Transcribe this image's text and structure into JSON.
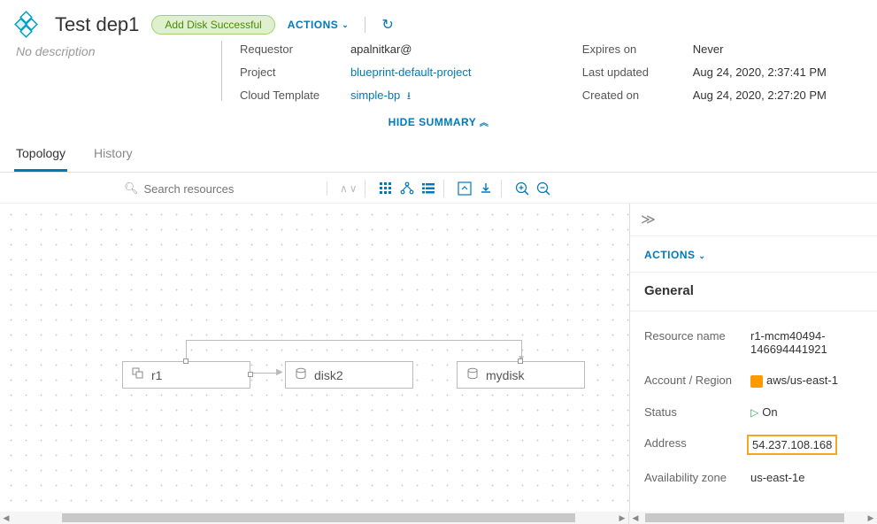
{
  "header": {
    "title": "Test dep1",
    "badge": "Add Disk Successful",
    "actions_label": "ACTIONS",
    "no_description": "No description"
  },
  "info": {
    "requestor_label": "Requestor",
    "requestor_value": "apalnitkar@",
    "project_label": "Project",
    "project_value": "blueprint-default-project",
    "template_label": "Cloud Template",
    "template_value": "simple-bp",
    "expires_label": "Expires on",
    "expires_value": "Never",
    "updated_label": "Last updated",
    "updated_value": "Aug 24, 2020, 2:37:41 PM",
    "created_label": "Created on",
    "created_value": "Aug 24, 2020, 2:27:20 PM"
  },
  "hide_summary": "HIDE SUMMARY",
  "tabs": {
    "topology": "Topology",
    "history": "History"
  },
  "toolbar": {
    "search_placeholder": "Search resources"
  },
  "nodes": {
    "r1": "r1",
    "disk2": "disk2",
    "mydisk": "mydisk"
  },
  "side": {
    "actions": "ACTIONS",
    "general": "General",
    "resource_name_label": "Resource name",
    "resource_name_value": "r1-mcm40494-146694441921",
    "account_label": "Account / Region",
    "account_value": "aws/us-east-1",
    "status_label": "Status",
    "status_value": "On",
    "address_label": "Address",
    "address_value": "54.237.108.168",
    "az_label": "Availability zone",
    "az_value": "us-east-1e"
  }
}
